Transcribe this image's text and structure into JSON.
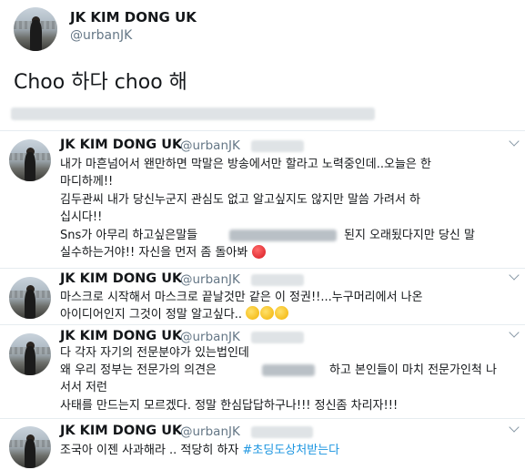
{
  "main_tweet": {
    "name": "JK KIM DONG UK",
    "handle": "@urbanJK",
    "text": "Choo 하다 choo 해"
  },
  "replies": [
    {
      "name": "JK KIM DONG UK",
      "handle": "@urbanJK",
      "lines": [
        "내가 마흔넘어서 왠만하면 막말은 방송에서만 할라고 노력중인데..오늘은 한",
        "마디하께!!",
        "김두관씨 내가 당신누군지 관심도 없고 알고싶지도 않지만 말씀 가려서 하",
        "십시다!!",
        "Sns가 아무리 하고싶은말들",
        "된지 오래됬다지만 당신 말",
        "실수하는거야!! 자신을 먼저 좀 돌아봐"
      ]
    },
    {
      "name": "JK KIM DONG UK",
      "handle": "@urbanJK",
      "lines": [
        "마스크로 시작해서 마스크로 끝날것만 같은 이 정권!!...누구머리에서 나온",
        "아이디어인지 그것이 정말 알고싶다.."
      ]
    },
    {
      "name": "JK KIM DONG UK",
      "handle": "@urbanJK",
      "lines": [
        "다 각자 자기의 전문분야가 있는법인데",
        "왜 우리 정부는 전문가의 의견은",
        "하고 본인들이 마치 전문가인척 나",
        "서서 저런",
        "사태를 만드는지 모르겠다. 정말 한심답답하구나!!! 정신좀 차리자!!!"
      ]
    },
    {
      "name": "JK KIM DONG UK",
      "handle": "@urbanJK",
      "text": "조국아 이젠 사과해라 .. 적당히 하자",
      "hashtag": "#초딩도상처받는다"
    }
  ]
}
